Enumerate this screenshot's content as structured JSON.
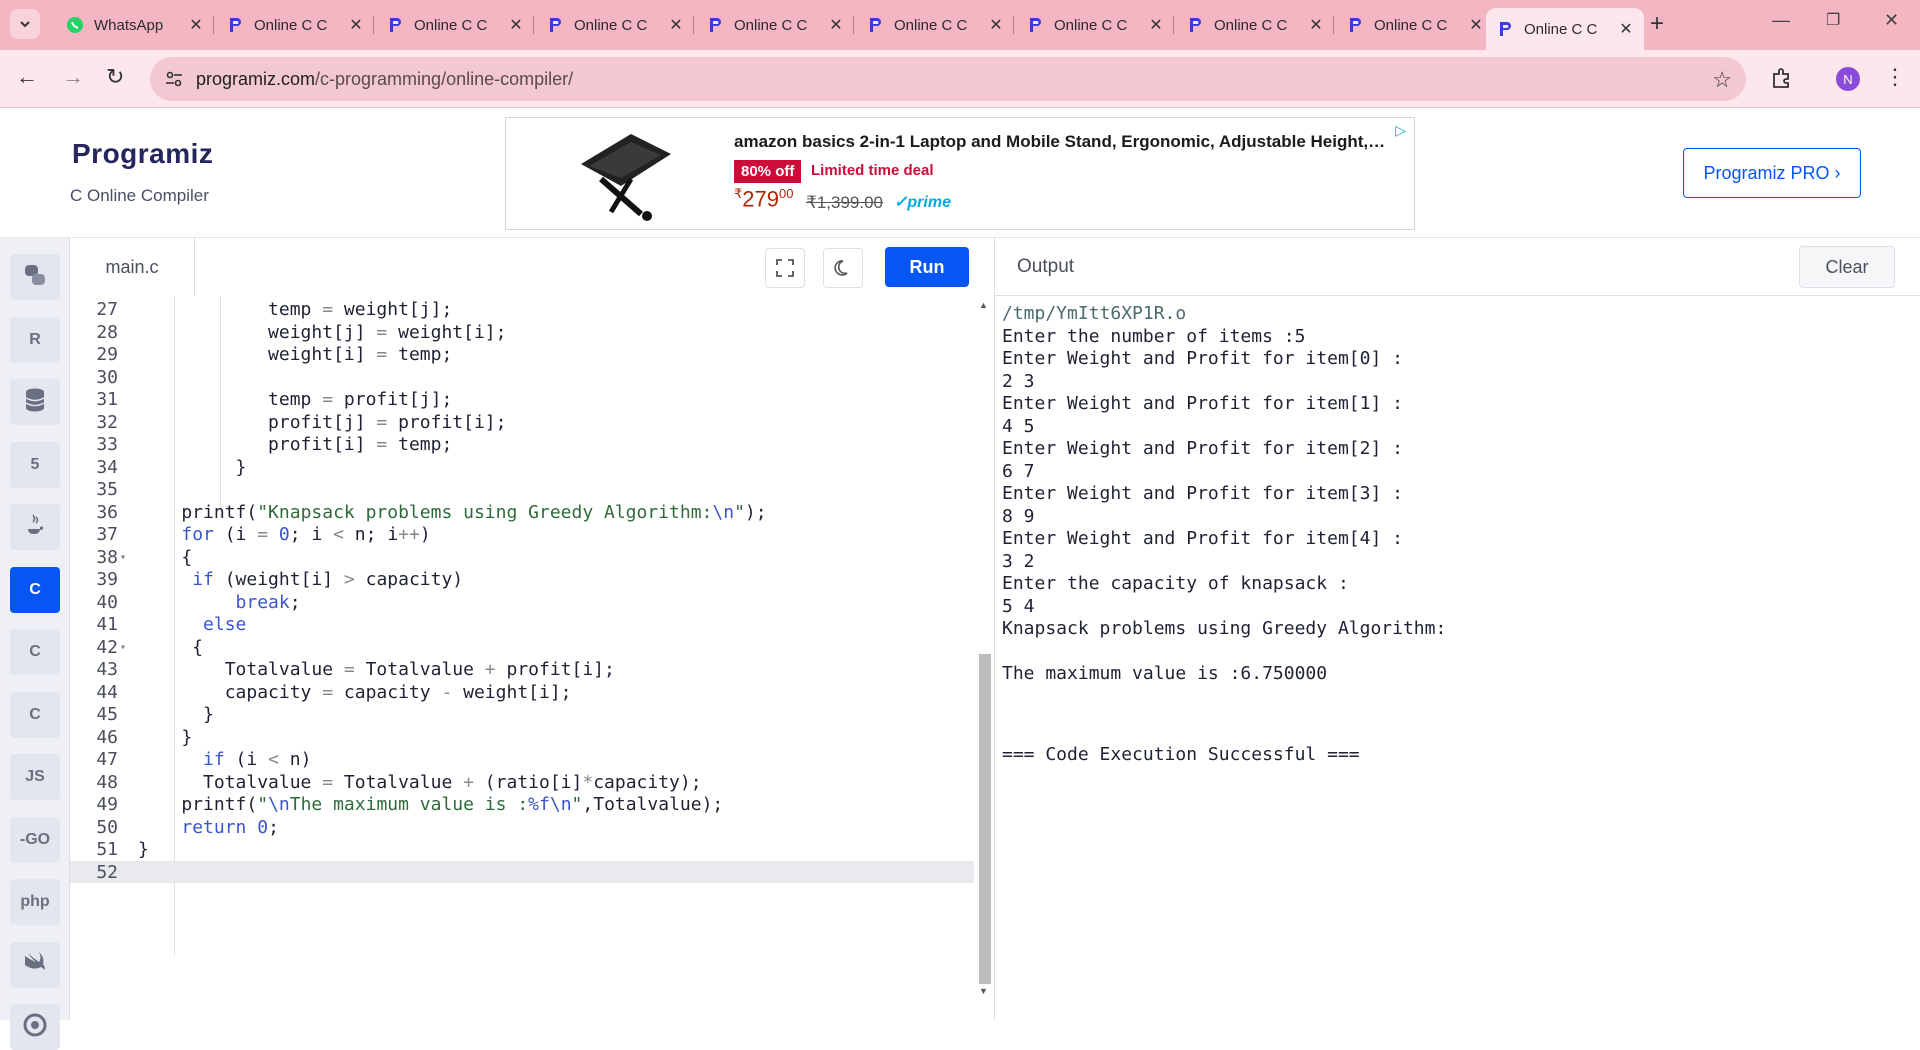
{
  "browser": {
    "tabs": [
      {
        "title": "WhatsApp",
        "icon": "whatsapp-icon"
      },
      {
        "title": "Online C C",
        "icon": "programiz-icon"
      },
      {
        "title": "Online C C",
        "icon": "programiz-icon"
      },
      {
        "title": "Online C C",
        "icon": "programiz-icon"
      },
      {
        "title": "Online C C",
        "icon": "programiz-icon"
      },
      {
        "title": "Online C C",
        "icon": "programiz-icon"
      },
      {
        "title": "Online C C",
        "icon": "programiz-icon"
      },
      {
        "title": "Online C C",
        "icon": "programiz-icon"
      },
      {
        "title": "Online C C",
        "icon": "programiz-icon"
      },
      {
        "title": "Online C C",
        "icon": "programiz-icon",
        "active": true
      }
    ],
    "url_host": "programiz.com",
    "url_path": "/c-programming/online-compiler/",
    "profile_initial": "N",
    "colors": {
      "tabstrip": "#f4b6c2",
      "toolbar": "#fde7ec"
    }
  },
  "site": {
    "logo": "Programiz",
    "subtitle": "C Online Compiler",
    "pro_button": "Programiz PRO ›",
    "accent": "#0556f3"
  },
  "ad": {
    "headline": "amazon basics 2-in-1 Laptop and Mobile Stand, Ergonomic, Adjustable Height,…",
    "badge": "80% off",
    "deal": "Limited time deal",
    "currency": "₹",
    "price": "279",
    "price_fraction": "00",
    "mrp": "₹1,399.00",
    "prime": "✓prime"
  },
  "rail": {
    "items": [
      {
        "name": "python",
        "label": "",
        "icon": "python-icon"
      },
      {
        "name": "r",
        "label": "R",
        "icon": "r-icon"
      },
      {
        "name": "sql",
        "label": "",
        "icon": "database-icon"
      },
      {
        "name": "html",
        "label": "5",
        "icon": "html5-icon"
      },
      {
        "name": "java",
        "label": "",
        "icon": "java-icon"
      },
      {
        "name": "c",
        "label": "C",
        "icon": "c-icon",
        "active": true
      },
      {
        "name": "cpp",
        "label": "C",
        "icon": "cpp-icon"
      },
      {
        "name": "csharp",
        "label": "C",
        "icon": "csharp-icon"
      },
      {
        "name": "js",
        "label": "JS",
        "icon": "js-icon"
      },
      {
        "name": "go",
        "label": "-GO",
        "icon": "go-icon"
      },
      {
        "name": "php",
        "label": "php",
        "icon": "php-icon"
      },
      {
        "name": "swift",
        "label": "",
        "icon": "swift-icon"
      },
      {
        "name": "rust",
        "label": "",
        "icon": "rust-icon"
      }
    ]
  },
  "editor": {
    "filename": "main.c",
    "run_label": "Run",
    "lines": [
      {
        "n": "27",
        "text": "            temp = weight[j];"
      },
      {
        "n": "28",
        "text": "            weight[j] = weight[i];"
      },
      {
        "n": "29",
        "text": "            weight[i] = temp;"
      },
      {
        "n": "30",
        "text": ""
      },
      {
        "n": "31",
        "text": "            temp = profit[j];"
      },
      {
        "n": "32",
        "text": "            profit[j] = profit[i];"
      },
      {
        "n": "33",
        "text": "            profit[i] = temp;"
      },
      {
        "n": "34",
        "text": "         }"
      },
      {
        "n": "35",
        "text": ""
      },
      {
        "n": "36",
        "text": "    printf(\"Knapsack problems using Greedy Algorithm:\\n\");"
      },
      {
        "n": "37",
        "text": "    for (i = 0; i < n; i++)"
      },
      {
        "n": "38",
        "text": "    {",
        "fold": true
      },
      {
        "n": "39",
        "text": "     if (weight[i] > capacity)"
      },
      {
        "n": "40",
        "text": "         break;"
      },
      {
        "n": "41",
        "text": "      else"
      },
      {
        "n": "42",
        "text": "     {",
        "fold": true
      },
      {
        "n": "43",
        "text": "        Totalvalue = Totalvalue + profit[i];"
      },
      {
        "n": "44",
        "text": "        capacity = capacity - weight[i];"
      },
      {
        "n": "45",
        "text": "      }"
      },
      {
        "n": "46",
        "text": "    }"
      },
      {
        "n": "47",
        "text": "      if (i < n)"
      },
      {
        "n": "48",
        "text": "      Totalvalue = Totalvalue + (ratio[i]*capacity);"
      },
      {
        "n": "49",
        "text": "    printf(\"\\nThe maximum value is :%f\\n\",Totalvalue);"
      },
      {
        "n": "50",
        "text": "    return 0;"
      },
      {
        "n": "51",
        "text": "}"
      },
      {
        "n": "52",
        "text": "",
        "current": true
      }
    ]
  },
  "output": {
    "title": "Output",
    "clear_label": "Clear",
    "lines": [
      "/tmp/YmItt6XP1R.o",
      "Enter the number of items :5",
      "Enter Weight and Profit for item[0] :",
      "2 3",
      "Enter Weight and Profit for item[1] :",
      "4 5",
      "Enter Weight and Profit for item[2] :",
      "6 7",
      "Enter Weight and Profit for item[3] :",
      "8 9",
      "Enter Weight and Profit for item[4] :",
      "3 2",
      "Enter the capacity of knapsack :",
      "5 4",
      "Knapsack problems using Greedy Algorithm:",
      "",
      "The maximum value is :6.750000",
      "",
      "",
      "=== Code Execution Successful ==="
    ]
  }
}
